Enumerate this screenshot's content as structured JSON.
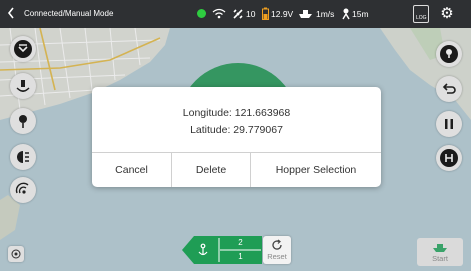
{
  "status": {
    "mode": "Connected/Manual Mode",
    "satellites": "10",
    "voltage": "12.9V",
    "speed": "1m/s",
    "distance": "15m",
    "log_label": "LOG"
  },
  "dialog": {
    "longitude": "Longitude: 121.663968",
    "latitude": "Latitude: 29.779067",
    "cancel": "Cancel",
    "delete": "Delete",
    "hopper_selection": "Hopper Selection"
  },
  "hopper": {
    "top": "2",
    "bottom": "1"
  },
  "controls": {
    "reset": "Reset",
    "start": "Start"
  },
  "colors": {
    "status_bar": "#2e3033",
    "accent_green": "#1f9d55",
    "water": "#bcd2db",
    "land": "#dfe3dc",
    "zone_green": "#3aa36a"
  },
  "icons": {
    "back": "chevron-left-icon",
    "gps": "gps-dot-icon",
    "wifi": "wifi-icon",
    "satellite": "satellite-icon",
    "battery": "battery-icon",
    "boat_speed": "boat-icon",
    "distance": "person-pin-icon",
    "log": "log-icon",
    "settings": "gear-icon"
  }
}
